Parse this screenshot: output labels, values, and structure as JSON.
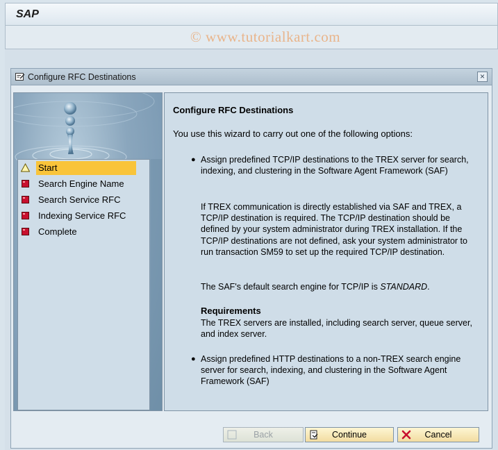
{
  "sap": {
    "logo": "SAP"
  },
  "watermark": "© www.tutorialkart.com",
  "dialog": {
    "title": "Configure RFC Destinations",
    "close_icon": "close-icon"
  },
  "steps": [
    {
      "label": "Start",
      "icon": "warning-triangle-icon",
      "active": true
    },
    {
      "label": "Search Engine Name",
      "icon": "red-square-icon"
    },
    {
      "label": "Search Service RFC",
      "icon": "red-square-icon"
    },
    {
      "label": "Indexing Service RFC",
      "icon": "red-square-icon"
    },
    {
      "label": "Complete",
      "icon": "red-square-icon"
    }
  ],
  "content": {
    "title": "Configure RFC Destinations",
    "intro": "You use this wizard to carry out one of the following options:",
    "bullet1": "Assign predefined TCP/IP destinations to the TREX server for search, indexing, and clustering in the Software Agent Framework (SAF)",
    "para1": "If TREX communication is directly established via SAF and TREX, a TCP/IP destination is required. The TCP/IP destination should be defined by your system administrator during TREX installation. If the TCP/IP destinations are not defined, ask your system administrator to run transaction SM59 to set up the required TCP/IP destination.",
    "para2_prefix": "The SAF's default search engine for TCP/IP is ",
    "para2_value": "STANDARD",
    "para2_suffix": ".",
    "req_head": "Requirements",
    "req_text": "The TREX servers are installed, including search server, queue server, and index server.",
    "bullet2": "Assign predefined HTTP destinations to a non-TREX search engine server for search, indexing, and clustering in the Software Agent Framework (SAF)"
  },
  "buttons": {
    "back": "Back",
    "continue": "Continue",
    "cancel": "Cancel"
  },
  "colors": {
    "active_step": "#f9c43a",
    "panel_bg": "#cfdde8",
    "button_bg": "#f2dca0"
  }
}
